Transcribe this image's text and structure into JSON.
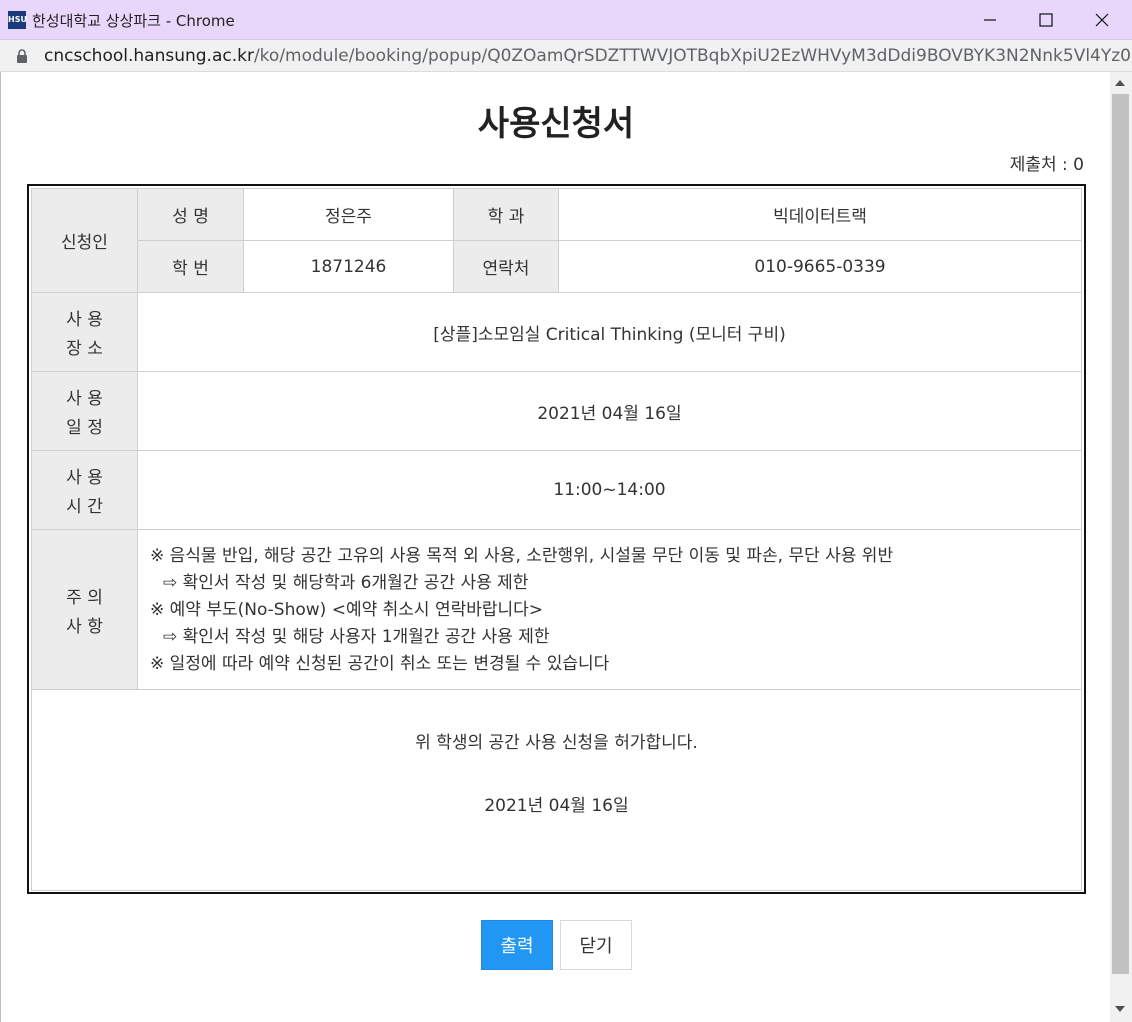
{
  "window": {
    "logo_text": "HSU",
    "title": "한성대학교 상상파크 - Chrome"
  },
  "address": {
    "host": "cncschool.hansung.ac.kr",
    "path": "/ko/module/booking/popup/Q0ZOamQrSDZTTWVJOTBqbXpiU2EzWHVyM3dDdi9BOVBYK3N2Nnk5Vl4Yz0="
  },
  "doc": {
    "title": "사용신청서",
    "submit_count": "제출처 : 0"
  },
  "applicant": {
    "label": "신청인",
    "name_label": "성 명",
    "name": "정은주",
    "dept_label": "학 과",
    "dept": "빅데이터트랙",
    "id_label": "학 번",
    "id": "1871246",
    "contact_label": "연락처",
    "contact": "010-9665-0339"
  },
  "place": {
    "label_1": "사 용",
    "label_2": "장 소",
    "value": "[상플]소모임실 Critical Thinking (모니터 구비)"
  },
  "schedule": {
    "label_1": "사 용",
    "label_2": "일 정",
    "value": "2021년 04월 16일"
  },
  "time": {
    "label_1": "사 용",
    "label_2": "시 간",
    "value": "11:00~14:00"
  },
  "notice": {
    "label_1": "주 의",
    "label_2": "사 항",
    "lines": [
      "※ 음식물 반입, 해당 공간 고유의 사용 목적 외 사용, 소란행위, 시설물 무단 이동 및 파손, 무단 사용 위반",
      "⇨ 확인서 작성 및 해당학과 6개월간 공간 사용 제한",
      "※ 예약 부도(No-Show) <예약 취소시 연락바랍니다>",
      "⇨ 확인서 작성 및 해당 사용자 1개월간 공간 사용 제한",
      "※ 일정에 따라 예약 신청된 공간이 취소 또는 변경될 수 있습니다"
    ]
  },
  "approval": {
    "text": "위 학생의 공간 사용 신청을 허가합니다.",
    "date": "2021년 04월 16일"
  },
  "buttons": {
    "print": "출력",
    "close": "닫기"
  },
  "colors": {
    "titlebar_bg": "#e8d7fb",
    "primary_button": "#2196f3",
    "label_cell_bg": "#ececec"
  }
}
